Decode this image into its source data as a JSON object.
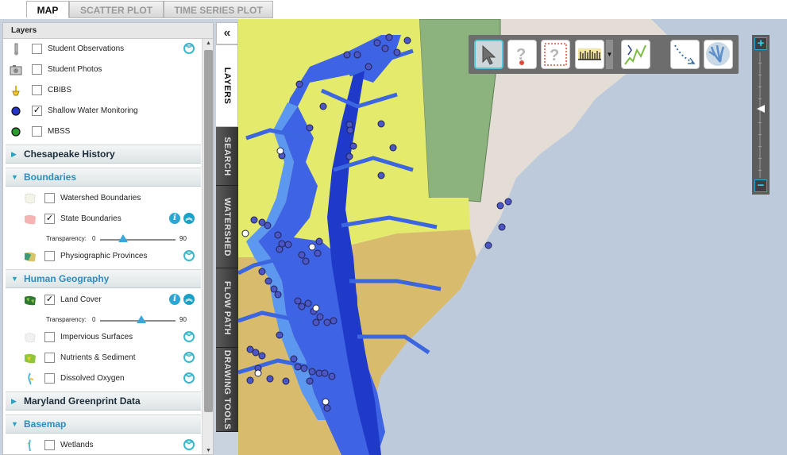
{
  "tabs": [
    {
      "label": "MAP",
      "active": true
    },
    {
      "label": "SCATTER PLOT",
      "active": false
    },
    {
      "label": "TIME SERIES PLOT",
      "active": false
    }
  ],
  "panel": {
    "title": "Layers",
    "observation_layers": [
      {
        "label": "Student Observations",
        "checked": false,
        "icon": "thermometer-icon",
        "expand": true
      },
      {
        "label": "Student Photos",
        "checked": false,
        "icon": "camera-icon",
        "expand": false
      },
      {
        "label": "CBIBS",
        "checked": false,
        "icon": "buoy-icon",
        "expand": false
      },
      {
        "label": "Shallow Water Monitoring",
        "checked": true,
        "icon": "blue-dot-icon",
        "expand": false
      },
      {
        "label": "MBSS",
        "checked": false,
        "icon": "green-dot-icon",
        "expand": false
      }
    ],
    "sections": [
      {
        "title": "Chesapeake History",
        "open": false
      },
      {
        "title": "Boundaries",
        "open": true
      },
      {
        "title": "Human Geography",
        "open": true
      },
      {
        "title": "Maryland Greenprint Data",
        "open": false
      },
      {
        "title": "Basemap",
        "open": true
      }
    ],
    "boundaries": [
      {
        "label": "Watershed Boundaries",
        "checked": false
      },
      {
        "label": "State Boundaries",
        "checked": true
      },
      {
        "label": "Physiographic Provinces",
        "checked": false
      }
    ],
    "human_geography": [
      {
        "label": "Land Cover",
        "checked": true
      },
      {
        "label": "Impervious Surfaces",
        "checked": false
      },
      {
        "label": "Nutrients & Sediment",
        "checked": false
      },
      {
        "label": "Dissolved Oxygen",
        "checked": false
      }
    ],
    "basemap": [
      {
        "label": "Wetlands",
        "checked": false
      }
    ],
    "transparency": {
      "label": "Transparency:",
      "min": "0",
      "max": "90",
      "state_boundaries_level": 0.3,
      "land_cover_level": 0.55
    }
  },
  "vertical_tabs": [
    "LAYERS",
    "SEARCH",
    "WATERSHED",
    "FLOW PATH",
    "DRAWING TOOLS"
  ],
  "toolbar": [
    "select-arrow",
    "identify-point",
    "identify-area",
    "profile-chart",
    "time-series",
    "flow-path",
    "watershed-trace"
  ],
  "colors": {
    "accent": "#2aa8cf",
    "water_dark": "#1f3fd8",
    "water_light": "#5aa0f0",
    "land_yellow": "#e4ea6c",
    "land_tan": "#d7b96a",
    "ocean": "#bccadc"
  }
}
